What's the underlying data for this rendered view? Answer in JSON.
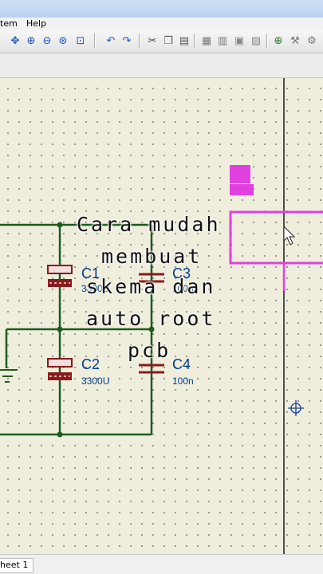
{
  "menu": {
    "items": [
      "tem",
      "Help"
    ]
  },
  "toolbar": {
    "icons": [
      "move-icon",
      "zoom-in-icon",
      "zoom-out-icon",
      "zoom-all-icon",
      "zoom-area-icon",
      "undo-icon",
      "redo-icon",
      "cut-icon",
      "copy-icon",
      "paste-icon",
      "block-copy-icon",
      "block-move-icon",
      "block-rotate-icon",
      "block-delete-icon",
      "pick-device-icon",
      "make-device-icon",
      "decompose-icon"
    ]
  },
  "schematic": {
    "components": [
      {
        "ref": "C1",
        "value": "3300U"
      },
      {
        "ref": "C2",
        "value": "3300U"
      },
      {
        "ref": "C3",
        "value": "100n"
      },
      {
        "ref": "C4",
        "value": "100n"
      }
    ],
    "colors": {
      "wire": "#1f5a1f",
      "component": "#8b1a1a",
      "selection": "#e040e0",
      "label": "#003b8f"
    }
  },
  "overlay": {
    "lines": [
      "Cara mudah",
      "membuat",
      "skema dan",
      "auto root",
      "pcb"
    ]
  },
  "status": {
    "sheet_tab": "heet 1"
  }
}
